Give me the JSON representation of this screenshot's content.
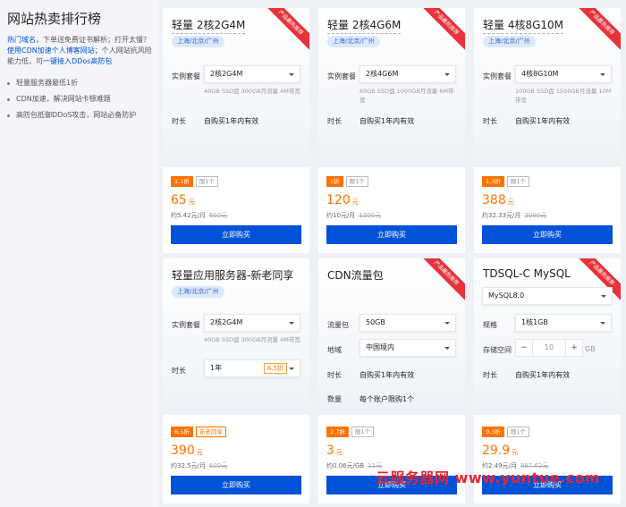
{
  "left": {
    "title": "网站热卖排行榜",
    "desc_link1": "热门域名",
    "desc_text1": "，下单送免费证书解析；打开太慢？",
    "desc_link2": "使用CDN加速个人博客网站",
    "desc_text2": "；个人网站抗风险能力低，可",
    "desc_link3": "一键接入DDos高防包",
    "bullets": [
      "轻量服务器最低1折",
      "CDN加速，解决网站卡顿难题",
      "高防包抵御DDoS攻击，网站必备防护"
    ]
  },
  "ribbon_text": "产品最热推荐",
  "common": {
    "plan_label": "实例套餐",
    "duration_label": "时长",
    "duration_value": "自购买1年内有效",
    "buy_label": "立即购买",
    "price_unit": "元"
  },
  "cards": [
    {
      "title": "轻量 2核2G4M",
      "region": "上海/北京/广州",
      "plan": "2核2G4M",
      "spec": "40GB SSD盘 300GB月流量 4M带宽",
      "discount": "1.1折",
      "limit": "限1个",
      "price": "65",
      "sub": "约5.42元/月",
      "orig": "600元"
    },
    {
      "title": "轻量 2核4G6M",
      "region": "上海/北京/广州",
      "plan": "2核4G6M",
      "spec": "60GB SSD盘 1000GB月流量 6M带宽",
      "discount": "1折",
      "limit": "限1个",
      "price": "120",
      "sub": "约10元/月",
      "orig": "1200元"
    },
    {
      "title": "轻量 4核8G10M",
      "region": "上海/北京/广州",
      "plan": "4核8G10M",
      "spec": "100GB SSD盘 1500GB月流量 10M带宽",
      "discount": "1.3折",
      "limit": "限1个",
      "price": "388",
      "sub": "约32.33元/月",
      "orig": "3060元"
    }
  ],
  "card4": {
    "title": "轻量应用服务器-新老同享",
    "region": "上海/北京/广州",
    "plan": "2核2G4M",
    "spec": "40GB SSD盘 300GB月流量 4M带宽",
    "duration": "1年",
    "duration_disc": "6.5折",
    "discount": "6.5折",
    "tag": "新老同享",
    "price": "390",
    "sub": "约32.5元/月",
    "orig": "600元"
  },
  "card5": {
    "title": "CDN流量包",
    "traffic_label": "流量包",
    "traffic": "50GB",
    "area_label": "地域",
    "area": "中国境内",
    "duration_label": "时长",
    "duration": "自购买1年内有效",
    "qty_label": "数量",
    "qty": "每个账户限购1个",
    "discount": "2.7折",
    "limit": "限1个",
    "price": "3",
    "sub": "约0.06元/GB",
    "orig": "11元"
  },
  "card6": {
    "title": "TDSQL-C MySQL",
    "version": "MySQL8.0",
    "spec_label": "规格",
    "spec": "1核1GB",
    "storage_label": "存储空间",
    "minus": "−",
    "storage": "10",
    "plus": "+",
    "storage_unit": "GB",
    "duration_label": "时长",
    "duration": "自购买1年内有效",
    "discount": "0.3折",
    "limit": "限1个",
    "price": "29.9",
    "sub": "约2.49元/月",
    "orig": "887.62元"
  },
  "watermark": "云服务器网 www.yuntue.com",
  "colors": {
    "brand": "#0052d9",
    "price": "#ff7200",
    "ribbon": "#e8313a"
  }
}
